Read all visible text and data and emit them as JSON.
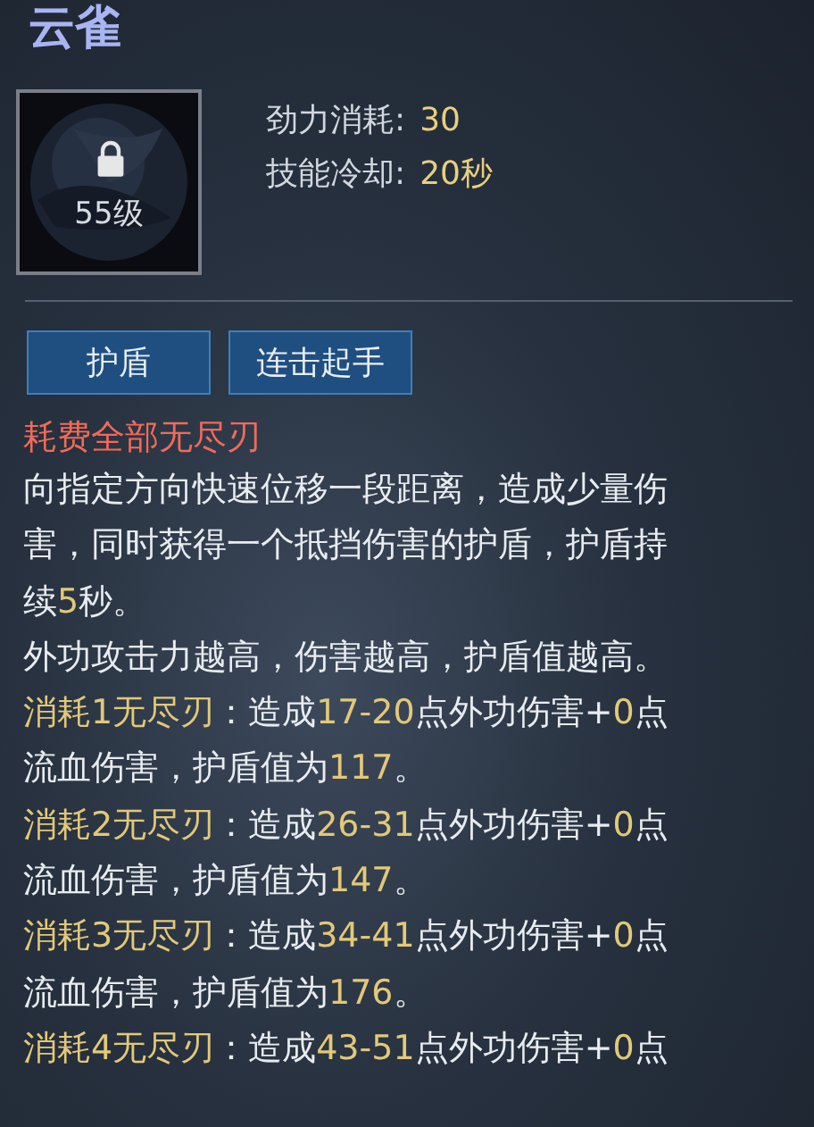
{
  "title": "云雀",
  "skill_icon": {
    "level": "55级",
    "locked": true
  },
  "stats": [
    {
      "label": "劲力消耗:",
      "value": "30"
    },
    {
      "label": "技能冷却:",
      "value": "20秒"
    }
  ],
  "tags": [
    "护盾",
    "连击起手"
  ],
  "cost_note": "耗费全部无尽刃",
  "lines": [
    {
      "segments": [
        {
          "text": "向指定方向快速位移一段距离，造成少量伤",
          "highlight": false
        }
      ]
    },
    {
      "segments": [
        {
          "text": "害，同时获得一个抵挡伤害的护盾，护盾持",
          "highlight": false
        }
      ]
    },
    {
      "segments": [
        {
          "text": "续",
          "highlight": false
        },
        {
          "text": "5",
          "highlight": true
        },
        {
          "text": "秒。",
          "highlight": false
        }
      ]
    },
    {
      "segments": [
        {
          "text": "外功攻击力越高，伤害越高，护盾值越高。",
          "highlight": false
        }
      ]
    },
    {
      "segments": [
        {
          "text": "消耗1无尽刃",
          "highlight": true
        },
        {
          "text": "：造成",
          "highlight": false
        },
        {
          "text": "17-20",
          "highlight": true
        },
        {
          "text": "点外功伤害+",
          "highlight": false
        },
        {
          "text": "0",
          "highlight": true
        },
        {
          "text": "点",
          "highlight": false
        }
      ]
    },
    {
      "segments": [
        {
          "text": "流血伤害，护盾值为",
          "highlight": false
        },
        {
          "text": "117",
          "highlight": true
        },
        {
          "text": "。",
          "highlight": false
        }
      ]
    },
    {
      "segments": [
        {
          "text": "消耗2无尽刃",
          "highlight": true
        },
        {
          "text": "：造成",
          "highlight": false
        },
        {
          "text": "26-31",
          "highlight": true
        },
        {
          "text": "点外功伤害+",
          "highlight": false
        },
        {
          "text": "0",
          "highlight": true
        },
        {
          "text": "点",
          "highlight": false
        }
      ]
    },
    {
      "segments": [
        {
          "text": "流血伤害，护盾值为",
          "highlight": false
        },
        {
          "text": "147",
          "highlight": true
        },
        {
          "text": "。",
          "highlight": false
        }
      ]
    },
    {
      "segments": [
        {
          "text": "消耗3无尽刃",
          "highlight": true
        },
        {
          "text": "：造成",
          "highlight": false
        },
        {
          "text": "34-41",
          "highlight": true
        },
        {
          "text": "点外功伤害+",
          "highlight": false
        },
        {
          "text": "0",
          "highlight": true
        },
        {
          "text": "点",
          "highlight": false
        }
      ]
    },
    {
      "segments": [
        {
          "text": "流血伤害，护盾值为",
          "highlight": false
        },
        {
          "text": "176",
          "highlight": true
        },
        {
          "text": "。",
          "highlight": false
        }
      ]
    },
    {
      "segments": [
        {
          "text": "消耗4无尽刃",
          "highlight": true
        },
        {
          "text": "：造成",
          "highlight": false
        },
        {
          "text": "43-51",
          "highlight": true
        },
        {
          "text": "点外功伤害+",
          "highlight": false
        },
        {
          "text": "0",
          "highlight": true
        },
        {
          "text": "点",
          "highlight": false
        }
      ]
    }
  ]
}
